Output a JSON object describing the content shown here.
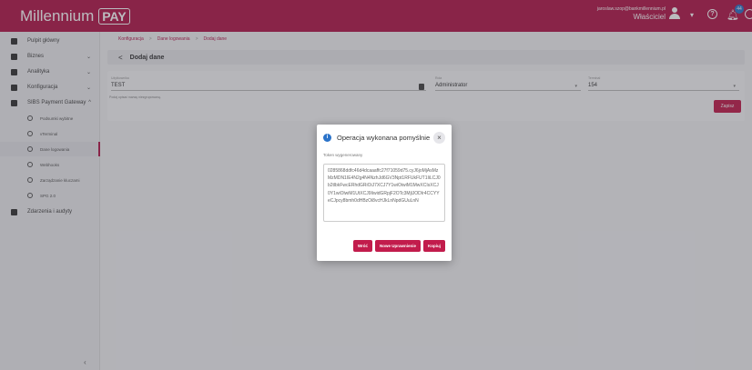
{
  "header": {
    "brand": "Millennium",
    "brand_badge": "PAY",
    "user_email": "jaroslaw.szop@bankmillennium.pl",
    "user_role": "Właściciel",
    "notifications_count": "44",
    "colors": {
      "brand": "#b3174a",
      "accent": "#c21c4c",
      "info": "#2b73c9"
    }
  },
  "sidebar": {
    "items": [
      {
        "label": "Pulpit główny",
        "icon": "dashboard-icon"
      },
      {
        "label": "Biznes",
        "icon": "briefcase-icon"
      },
      {
        "label": "Analityka",
        "icon": "chart-icon"
      },
      {
        "label": "Konfiguracja",
        "icon": "gear-icon"
      },
      {
        "label": "SIBS Payment Gateway",
        "icon": "gateway-icon"
      }
    ],
    "subitems": [
      {
        "label": "Podsumki wybitne",
        "icon": "clock-icon"
      },
      {
        "label": "vTerminal",
        "icon": "terminal-icon"
      },
      {
        "label": "Dane logowania",
        "icon": "login-icon"
      },
      {
        "label": "Webhooks",
        "icon": "webhook-icon"
      },
      {
        "label": "Zarządzanie kluczami",
        "icon": "key-settings-icon"
      },
      {
        "label": "SPG 2.0",
        "icon": "lock-icon"
      }
    ],
    "footer_item": {
      "label": "Zdarzenia i audyty",
      "icon": "audit-icon"
    }
  },
  "breadcrumb": [
    "Konfiguracja",
    "Dane logowania",
    "Dodaj dane"
  ],
  "page": {
    "title": "Dodaj dane",
    "fields": [
      {
        "label": "Użytkownika",
        "value": "TEST"
      },
      {
        "label": "Rola",
        "value": "Administrator"
      },
      {
        "label": "Terminal",
        "value": "154"
      }
    ],
    "hint": "Podaj opisać nazwę niezgrupowaną.",
    "save_label": "Zapisz"
  },
  "modal": {
    "title": "Operacja wykonana pomyślnie",
    "token_label": "Token wygenerowany",
    "token": "0285868ddfc46d4dcaaaffc27f71059d75.cyJ6joMjAsMzMzMDN1IE4N2g4N4NzhJd6GV3Npt1RFUkFUT1IiLCJ0b2tlbkFwcERhdGRiOiJ7XCJ7Y1wiOiwiM1MwXCIsXCJ0Y1wiOlwiM1UtXCJ9IiwidGRpjF2OTc3MjlJODIr4CCYYeCJpcy8bmh0dHBzOi8vcHJkLnNpdGUuLnN",
    "buttons": [
      "Wróć",
      "Nowe Uprawnienie",
      "Kopiuj"
    ]
  }
}
